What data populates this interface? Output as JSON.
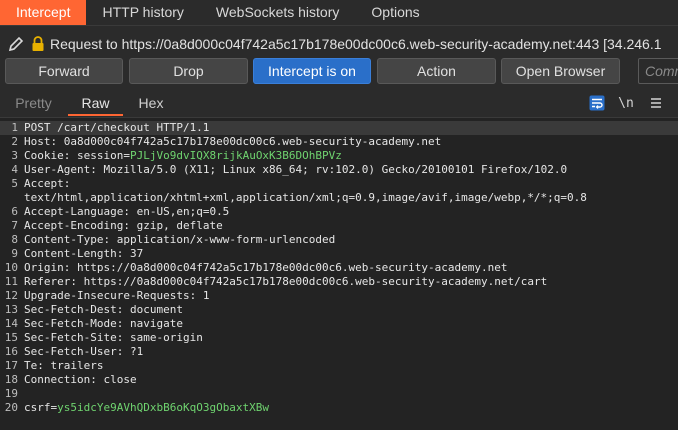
{
  "tabs": [
    {
      "label": "Intercept",
      "active": true
    },
    {
      "label": "HTTP history",
      "active": false
    },
    {
      "label": "WebSockets history",
      "active": false
    },
    {
      "label": "Options",
      "active": false
    }
  ],
  "request_header": {
    "icon_edit": "pencil-icon",
    "icon_lock": "lock-icon",
    "text": "Request to https://0a8d000c04f742a5c17b178e00dc00c6.web-security-academy.net:443  [34.246.1"
  },
  "buttons": {
    "forward": "Forward",
    "drop": "Drop",
    "intercept": "Intercept is on",
    "action": "Action",
    "open_browser": "Open Browser",
    "comment_placeholder": "Comm"
  },
  "editor_tabs": {
    "pretty": "Pretty",
    "raw": "Raw",
    "hex": "Hex",
    "active": "Raw",
    "newline_toggle": "\\n"
  },
  "colors": {
    "accent": "#ff6633",
    "intercept_on": "#2a6fc9",
    "value_green": "#6fd36f"
  },
  "request_lines": [
    {
      "n": "1",
      "text": "POST /cart/checkout HTTP/1.1",
      "highlight": true
    },
    {
      "n": "2",
      "key": "Host",
      "value": "0a8d000c04f742a5c17b178e00dc00c6.web-security-academy.net"
    },
    {
      "n": "3",
      "key": "Cookie",
      "prefix": "session=",
      "green": "PJLjVo9dvIQX8rijkAuOxK3B6DOhBPVz"
    },
    {
      "n": "4",
      "key": "User-Agent",
      "value": "Mozilla/5.0 (X11; Linux x86_64; rv:102.0) Gecko/20100101 Firefox/102.0"
    },
    {
      "n": "5",
      "key": "Accept",
      "value": ""
    },
    {
      "n": "",
      "text": "text/html,application/xhtml+xml,application/xml;q=0.9,image/avif,image/webp,*/*;q=0.8"
    },
    {
      "n": "6",
      "key": "Accept-Language",
      "value": "en-US,en;q=0.5"
    },
    {
      "n": "7",
      "key": "Accept-Encoding",
      "value": "gzip, deflate"
    },
    {
      "n": "8",
      "key": "Content-Type",
      "value": "application/x-www-form-urlencoded"
    },
    {
      "n": "9",
      "key": "Content-Length",
      "value": "37"
    },
    {
      "n": "10",
      "key": "Origin",
      "value": "https://0a8d000c04f742a5c17b178e00dc00c6.web-security-academy.net"
    },
    {
      "n": "11",
      "key": "Referer",
      "value": "https://0a8d000c04f742a5c17b178e00dc00c6.web-security-academy.net/cart"
    },
    {
      "n": "12",
      "key": "Upgrade-Insecure-Requests",
      "value": "1"
    },
    {
      "n": "13",
      "key": "Sec-Fetch-Dest",
      "value": "document"
    },
    {
      "n": "14",
      "key": "Sec-Fetch-Mode",
      "value": "navigate"
    },
    {
      "n": "15",
      "key": "Sec-Fetch-Site",
      "value": "same-origin"
    },
    {
      "n": "16",
      "key": "Sec-Fetch-User",
      "value": "?1"
    },
    {
      "n": "17",
      "key": "Te",
      "value": "trailers"
    },
    {
      "n": "18",
      "key": "Connection",
      "value": "close"
    },
    {
      "n": "19",
      "text": ""
    },
    {
      "n": "20",
      "prefix": "csrf=",
      "green": "ys5idcYe9AVhQDxbB6oKqO3gObaxtXBw"
    }
  ]
}
